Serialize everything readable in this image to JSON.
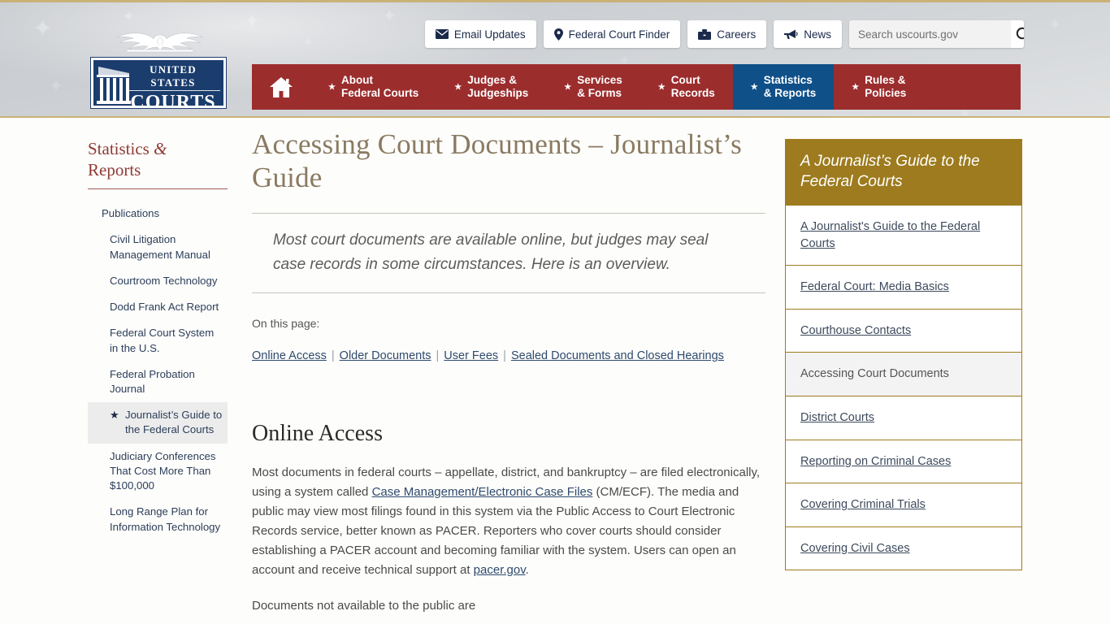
{
  "header": {
    "logo": {
      "line1": "UNITED STATES",
      "line2": "COURTS",
      "eagle_icon": "eagle-icon",
      "columns_icon": "courthouse-columns-icon"
    },
    "utility": [
      {
        "label": "Email Updates",
        "icon": "envelope-icon"
      },
      {
        "label": "Federal Court Finder",
        "icon": "map-pin-icon"
      },
      {
        "label": "Careers",
        "icon": "briefcase-icon"
      },
      {
        "label": "News",
        "icon": "megaphone-icon"
      }
    ],
    "search": {
      "placeholder": "Search uscourts.gov",
      "value": "",
      "icon": "search-icon"
    },
    "nav": {
      "home_icon": "home-icon",
      "items": [
        {
          "line1": "About",
          "line2": "Federal Courts",
          "active": false
        },
        {
          "line1": "Judges &",
          "line2": "Judgeships",
          "active": false
        },
        {
          "line1": "Services",
          "line2": "& Forms",
          "active": false
        },
        {
          "line1": "Court",
          "line2": "Records",
          "active": false
        },
        {
          "line1": "Statistics",
          "line2": "& Reports",
          "active": true
        },
        {
          "line1": "Rules &",
          "line2": "Policies",
          "active": false
        }
      ]
    }
  },
  "left_sidebar": {
    "title_part1": "Statistics ",
    "title_amp": "&",
    "title_part2": "Reports",
    "items": [
      {
        "label": "Publications",
        "level": 0,
        "active": false
      },
      {
        "label": "Civil Litigation Management Manual",
        "level": 1,
        "active": false
      },
      {
        "label": "Courtroom Technology",
        "level": 1,
        "active": false
      },
      {
        "label": "Dodd Frank Act Report",
        "level": 1,
        "active": false
      },
      {
        "label": "Federal Court System in the U.S.",
        "level": 1,
        "active": false
      },
      {
        "label": "Federal Probation Journal",
        "level": 1,
        "active": false
      },
      {
        "label": "Journalist’s Guide to the Federal Courts",
        "level": 1,
        "active": true,
        "icon": "star-icon"
      },
      {
        "label": "Judiciary Conferences That Cost More Than $100,000",
        "level": 1,
        "active": false
      },
      {
        "label": "Long Range Plan for Information Technology",
        "level": 1,
        "active": false
      }
    ]
  },
  "main": {
    "title": "Accessing Court Documents – Journalist’s Guide",
    "deck": "Most court documents are available online, but judges may seal case records in some circumstances. Here is an overview.",
    "on_this_page_label": "On this page:",
    "on_this_page_links": [
      "Online Access",
      "Older Documents",
      "User Fees",
      "Sealed Documents and Closed Hearings"
    ],
    "section_title": "Online Access",
    "paragraph1": {
      "part1": "Most documents in federal courts – appellate, district, and bankruptcy – are filed electronically, using a system called ",
      "link1": "Case Management/Electronic Case Files",
      "part2": " (CM/ECF). The media and public may view most filings found in this system via the Public Access to Court Electronic Records service, better known as PACER. Reporters who cover courts should consider establishing a PACER account and becoming familiar with the system. Users can open an account and receive technical support at ",
      "link2": "pacer.gov",
      "part3": "."
    },
    "paragraph2": "Documents not available to the public are"
  },
  "right_sidebar": {
    "heading": "A Journalist’s Guide to the Federal Courts",
    "items": [
      {
        "label": "A Journalist's Guide to the Federal Courts",
        "current": false
      },
      {
        "label": "Federal Court: Media Basics",
        "current": false
      },
      {
        "label": "Courthouse Contacts",
        "current": false
      },
      {
        "label": "Accessing Court Documents",
        "current": true
      },
      {
        "label": "District Courts",
        "current": false
      },
      {
        "label": "Reporting on Criminal Cases",
        "current": false
      },
      {
        "label": "Covering Criminal Trials",
        "current": false
      },
      {
        "label": "Covering Civil Cases",
        "current": false
      }
    ]
  },
  "colors": {
    "nav_red": "#9c2d2d",
    "nav_active_blue": "#0f5089",
    "gold": "#9d7b1e",
    "header_rule_gold": "#c9b277",
    "title_brown": "#8a7a62",
    "sidebar_heading_red": "#8f3a36",
    "link_blue": "#2e4a6e",
    "page_bg": "#fdfdfb"
  }
}
